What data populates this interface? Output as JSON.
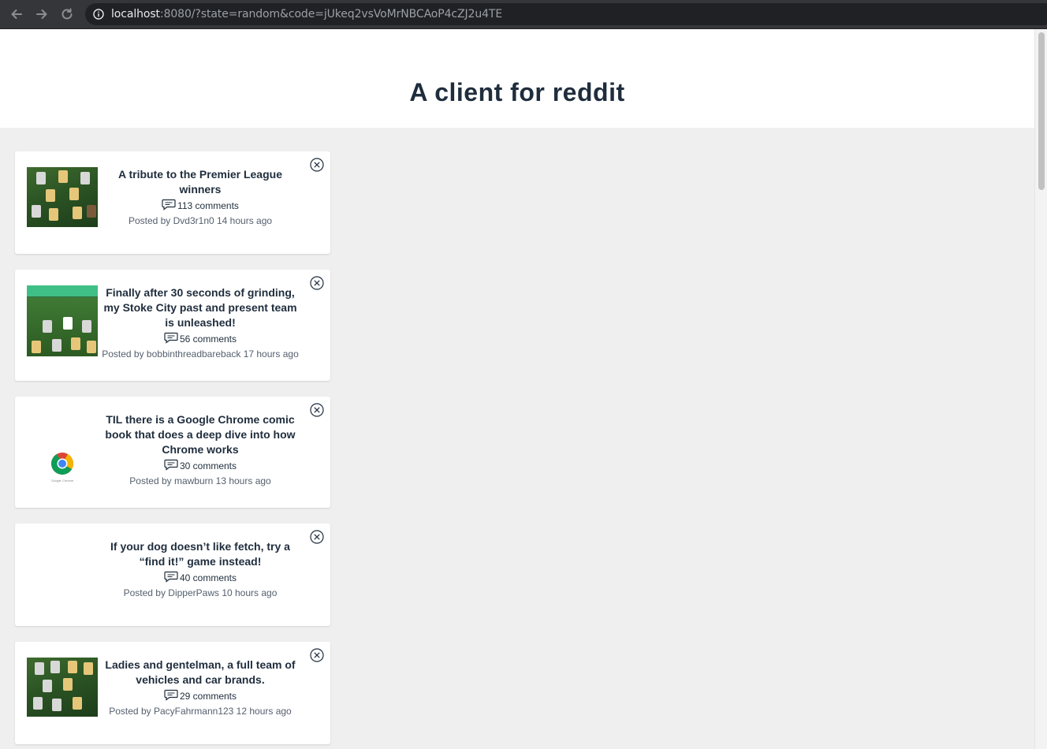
{
  "browser": {
    "url_host": "localhost",
    "url_rest": ":8080/?state=random&code=jUkeq2vsVoMrNBCAoP4cZJ2u4TE",
    "icons": {
      "back": "back-arrow-icon",
      "forward": "forward-arrow-icon",
      "reload": "reload-icon",
      "info": "info-icon"
    }
  },
  "page": {
    "title": "A client for reddit"
  },
  "posts": [
    {
      "title": "A tribute to the Premier League winners",
      "comments": "113 comments",
      "meta": "Posted by Dvd3r1n0 14 hours ago"
    },
    {
      "title": "Finally after 30 seconds of grinding, my Stoke City past and present team is unleashed!",
      "comments": "56 comments",
      "meta": "Posted by bobbinthreadbareback 17 hours ago"
    },
    {
      "title": "TIL there is a Google Chrome comic book that does a deep dive into how Chrome works",
      "comments": "30 comments",
      "meta": "Posted by mawburn 13 hours ago",
      "thumb_caption": "Google Chrome"
    },
    {
      "title": "If your dog doesn’t like fetch, try a “find it!” game instead!",
      "comments": "40 comments",
      "meta": "Posted by DipperPaws 10 hours ago"
    },
    {
      "title": "Ladies and gentelman, a full team of vehicles and car brands.",
      "comments": "29 comments",
      "meta": "Posted by PacyFahrmann123 12 hours ago"
    }
  ],
  "colors": {
    "header_bg": "#ffffff",
    "page_bg": "#efefef",
    "title": "#1f2d3d",
    "browser_bar": "#35363a"
  }
}
